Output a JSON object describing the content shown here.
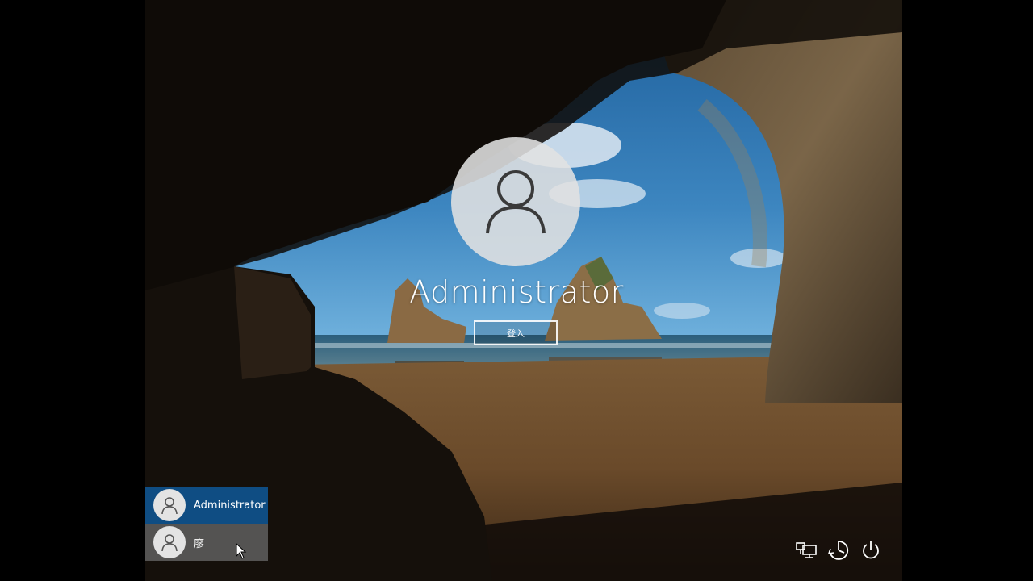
{
  "lock_screen": {
    "selected_user_name": "Administrator",
    "signin_button_label": "登入"
  },
  "user_list": {
    "items": [
      {
        "label": "Administrator",
        "selected": true
      },
      {
        "label": "廖",
        "selected": false
      }
    ]
  },
  "system_icons": [
    "network-icon",
    "ease-of-access-icon",
    "power-icon"
  ],
  "colors": {
    "selected_user_bg": "#0f4d83",
    "avatar_bg": "#e3e3e3",
    "background": "#000000"
  }
}
